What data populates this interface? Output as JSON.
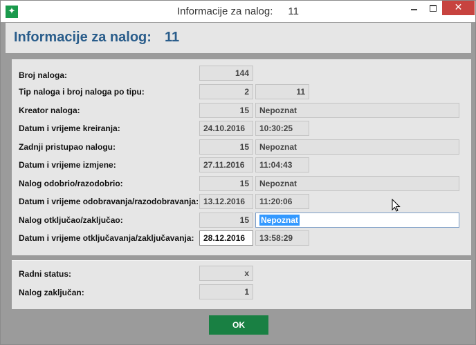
{
  "window": {
    "title": "Informacije za nalog:",
    "title_number": "11",
    "close_glyph": "✕"
  },
  "heading": {
    "title": "Informacije za nalog:",
    "number": "11"
  },
  "rows": [
    {
      "label": "Broj naloga:",
      "value1": "144"
    },
    {
      "label": "Tip naloga i broj naloga po tipu:",
      "value1": "2",
      "value2": "11"
    },
    {
      "label": "Kreator naloga:",
      "value1": "15",
      "value2": "Nepoznat"
    },
    {
      "label": "Datum i vrijeme kreiranja:",
      "value1": "24.10.2016",
      "value2": "10:30:25"
    },
    {
      "label": "Zadnji pristupao nalogu:",
      "value1": "15",
      "value2": "Nepoznat"
    },
    {
      "label": "Datum i vrijeme izmjene:",
      "value1": "27.11.2016",
      "value2": "11:04:43"
    },
    {
      "label": "Nalog odobrio/razodobrio:",
      "value1": "15",
      "value2": "Nepoznat"
    },
    {
      "label": "Datum i vrijeme odobravanja/razodobravanja:",
      "value1": "13.12.2016",
      "value2": "11:20:06"
    },
    {
      "label": "Nalog otključao/zaključao:",
      "value1": "15",
      "value2": "Nepoznat"
    },
    {
      "label": "Datum i vrijeme otključavanja/zaključavanja:",
      "value1": "28.12.2016",
      "value2": "13:58:29"
    }
  ],
  "status": [
    {
      "label": "Radni status:",
      "value": "x"
    },
    {
      "label": "Nalog zaključan:",
      "value": "1"
    }
  ],
  "ok_label": "OK",
  "icons": {
    "app": "app-star-icon",
    "cursor": "mouse-pointer-icon"
  },
  "colors": {
    "heading": "#2a5d8b",
    "ok_button": "#198043",
    "close_button": "#c7433f",
    "selection": "#3399ff"
  }
}
